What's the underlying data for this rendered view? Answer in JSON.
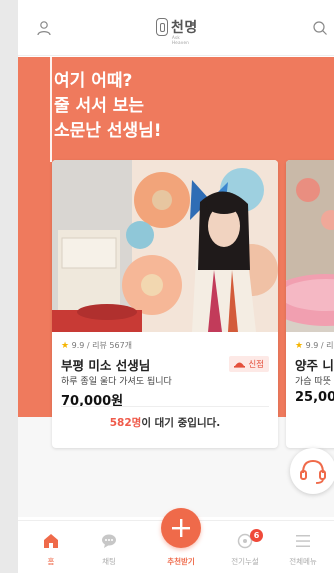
{
  "header": {
    "logo_text": "천명",
    "logo_sub": "Ask Heaven"
  },
  "banner": {
    "line1": "여기 어때?",
    "line2": "줄 서서 보는",
    "line3": "소문난 선생님!"
  },
  "cards": [
    {
      "rating": "9.9 / 리뷰 567개",
      "name": "부평 미소 선생님",
      "badge": "신점",
      "desc": "하루 종일 울다 가셔도 됩니다",
      "price": "70,000원",
      "waiting_count": "582명",
      "waiting_text": "이 대기 중입니다."
    },
    {
      "rating": "9.9 / 리",
      "name": "양주 니",
      "desc": "가슴 따뜻",
      "price": "25,000"
    }
  ],
  "nav": {
    "items": [
      {
        "label": "홈",
        "icon": "home-icon"
      },
      {
        "label": "채팅",
        "icon": "chat-icon"
      },
      {
        "label": "추천받기",
        "icon": "plus-icon"
      },
      {
        "label": "전기누설",
        "icon": "notification-icon",
        "badge": "6"
      },
      {
        "label": "전체메뉴",
        "icon": "menu-icon"
      }
    ]
  },
  "colors": {
    "accent": "#ef7a5d",
    "brand": "#ef6a4a"
  }
}
